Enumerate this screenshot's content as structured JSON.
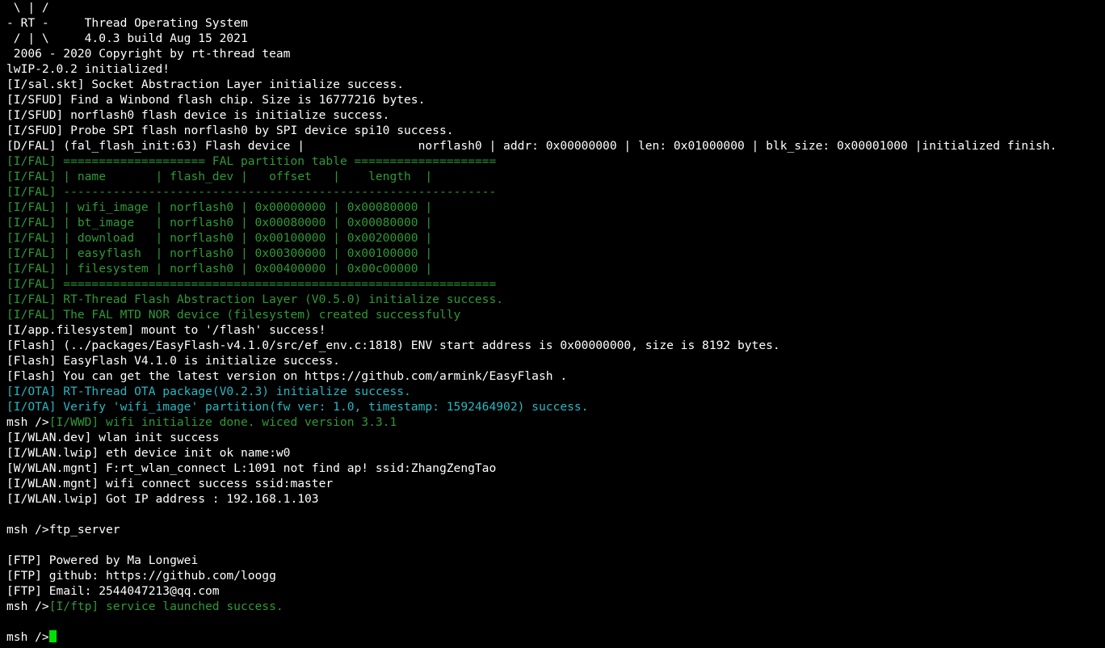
{
  "colors": {
    "background": "#000000",
    "default_text": "#ffffff",
    "log_green": "#2e9a36",
    "log_cyan": "#27b7c2",
    "cursor": "#00e000"
  },
  "lines": [
    {
      "segs": [
        {
          "t": " \\ | /",
          "c": "w"
        }
      ]
    },
    {
      "segs": [
        {
          "t": "- RT -     Thread Operating System",
          "c": "w"
        }
      ]
    },
    {
      "segs": [
        {
          "t": " / | \\     4.0.3 build Aug 15 2021",
          "c": "w"
        }
      ]
    },
    {
      "segs": [
        {
          "t": " 2006 - 2020 Copyright by rt-thread team",
          "c": "w"
        }
      ]
    },
    {
      "segs": [
        {
          "t": "lwIP-2.0.2 initialized!",
          "c": "w"
        }
      ]
    },
    {
      "segs": [
        {
          "t": "[I/sal.skt] Socket Abstraction Layer initialize success.",
          "c": "w"
        }
      ]
    },
    {
      "segs": [
        {
          "t": "[I/SFUD] Find a Winbond flash chip. Size is 16777216 bytes.",
          "c": "w"
        }
      ]
    },
    {
      "segs": [
        {
          "t": "[I/SFUD] norflash0 flash device is initialize success.",
          "c": "w"
        }
      ]
    },
    {
      "segs": [
        {
          "t": "[I/SFUD] Probe SPI flash norflash0 by SPI device spi10 success.",
          "c": "w"
        }
      ]
    },
    {
      "segs": [
        {
          "t": "[D/FAL] (fal_flash_init:63) Flash device |                norflash0 | addr: 0x00000000 | len: 0x01000000 | blk_size: 0x00001000 |initialized finish.",
          "c": "w"
        }
      ]
    },
    {
      "segs": [
        {
          "t": "[I/FAL] ==================== FAL partition table ====================",
          "c": "g"
        }
      ]
    },
    {
      "segs": [
        {
          "t": "[I/FAL] | name       | flash_dev |   offset   |    length  |",
          "c": "g"
        }
      ]
    },
    {
      "segs": [
        {
          "t": "[I/FAL] -------------------------------------------------------------",
          "c": "g"
        }
      ]
    },
    {
      "segs": [
        {
          "t": "[I/FAL] | wifi_image | norflash0 | 0x00000000 | 0x00080000 |",
          "c": "g"
        }
      ]
    },
    {
      "segs": [
        {
          "t": "[I/FAL] | bt_image   | norflash0 | 0x00080000 | 0x00080000 |",
          "c": "g"
        }
      ]
    },
    {
      "segs": [
        {
          "t": "[I/FAL] | download   | norflash0 | 0x00100000 | 0x00200000 |",
          "c": "g"
        }
      ]
    },
    {
      "segs": [
        {
          "t": "[I/FAL] | easyflash  | norflash0 | 0x00300000 | 0x00100000 |",
          "c": "g"
        }
      ]
    },
    {
      "segs": [
        {
          "t": "[I/FAL] | filesystem | norflash0 | 0x00400000 | 0x00c00000 |",
          "c": "g"
        }
      ]
    },
    {
      "segs": [
        {
          "t": "[I/FAL] =============================================================",
          "c": "g"
        }
      ]
    },
    {
      "segs": [
        {
          "t": "[I/FAL] RT-Thread Flash Abstraction Layer (V0.5.0) initialize success.",
          "c": "g"
        }
      ]
    },
    {
      "segs": [
        {
          "t": "[I/FAL] The FAL MTD NOR device (filesystem) created successfully",
          "c": "g"
        }
      ]
    },
    {
      "segs": [
        {
          "t": "[I/app.filesystem] mount to '/flash' success!",
          "c": "w"
        }
      ]
    },
    {
      "segs": [
        {
          "t": "[Flash] (../packages/EasyFlash-v4.1.0/src/ef_env.c:1818) ENV start address is 0x00000000, size is 8192 bytes.",
          "c": "w"
        }
      ]
    },
    {
      "segs": [
        {
          "t": "[Flash] EasyFlash V4.1.0 is initialize success.",
          "c": "w"
        }
      ]
    },
    {
      "segs": [
        {
          "t": "[Flash] You can get the latest version on https://github.com/armink/EasyFlash .",
          "c": "w"
        }
      ]
    },
    {
      "segs": [
        {
          "t": "[I/OTA] RT-Thread OTA package(V0.2.3) initialize success.",
          "c": "c"
        }
      ]
    },
    {
      "segs": [
        {
          "t": "[I/OTA] Verify 'wifi_image' partition(fw ver: 1.0, timestamp: 1592464902) success.",
          "c": "c"
        }
      ]
    },
    {
      "segs": [
        {
          "t": "msh />",
          "c": "w"
        },
        {
          "t": "[I/WWD] wifi initialize done. wiced version 3.3.1",
          "c": "g"
        }
      ]
    },
    {
      "segs": [
        {
          "t": "[I/WLAN.dev] wlan init success",
          "c": "w"
        }
      ]
    },
    {
      "segs": [
        {
          "t": "[I/WLAN.lwip] eth device init ok name:w0",
          "c": "w"
        }
      ]
    },
    {
      "segs": [
        {
          "t": "[W/WLAN.mgnt] F:rt_wlan_connect L:1091 not find ap! ssid:ZhangZengTao",
          "c": "w"
        }
      ]
    },
    {
      "segs": [
        {
          "t": "[I/WLAN.mgnt] wifi connect success ssid:master",
          "c": "w"
        }
      ]
    },
    {
      "segs": [
        {
          "t": "[I/WLAN.lwip] Got IP address : 192.168.1.103",
          "c": "w"
        }
      ]
    },
    {
      "segs": [
        {
          "t": "",
          "c": "w"
        }
      ]
    },
    {
      "segs": [
        {
          "t": "msh />ftp_server",
          "c": "w"
        }
      ]
    },
    {
      "segs": [
        {
          "t": "",
          "c": "w"
        }
      ]
    },
    {
      "segs": [
        {
          "t": "[FTP] Powered by Ma Longwei",
          "c": "w"
        }
      ]
    },
    {
      "segs": [
        {
          "t": "[FTP] github: https://github.com/loogg",
          "c": "w"
        }
      ]
    },
    {
      "segs": [
        {
          "t": "[FTP] Email: 2544047213@qq.com",
          "c": "w"
        }
      ]
    },
    {
      "segs": [
        {
          "t": "msh />",
          "c": "w"
        },
        {
          "t": "[I/ftp] service launched success.",
          "c": "g"
        }
      ]
    },
    {
      "segs": [
        {
          "t": "",
          "c": "w"
        }
      ]
    },
    {
      "segs": [
        {
          "t": "msh />",
          "c": "w"
        }
      ],
      "cursor": true
    }
  ]
}
